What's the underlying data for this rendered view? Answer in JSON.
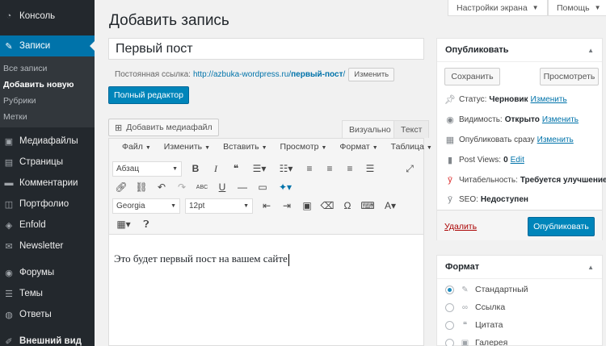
{
  "sidebar": {
    "items": [
      {
        "label": "Консоль",
        "icon": "dashboard-icon"
      },
      {
        "label": "Записи",
        "icon": "pin-icon"
      },
      {
        "label": "Медиафайлы",
        "icon": "media-icon"
      },
      {
        "label": "Страницы",
        "icon": "pages-icon"
      },
      {
        "label": "Комментарии",
        "icon": "comments-icon"
      },
      {
        "label": "Портфолио",
        "icon": "portfolio-icon"
      },
      {
        "label": "Enfold",
        "icon": "enfold-icon"
      },
      {
        "label": "Newsletter",
        "icon": "newsletter-icon"
      },
      {
        "label": "Форумы",
        "icon": "forums-icon"
      },
      {
        "label": "Темы",
        "icon": "topics-icon"
      },
      {
        "label": "Ответы",
        "icon": "replies-icon"
      },
      {
        "label": "Внешний вид",
        "icon": "appearance-icon"
      }
    ],
    "submenu": [
      "Все записи",
      "Добавить новую",
      "Рубрики",
      "Метки"
    ]
  },
  "header": {
    "screen_options": "Настройки экрана",
    "help": "Помощь",
    "page_title": "Добавить запись"
  },
  "post": {
    "title": "Первый пост",
    "permalink_label": "Постоянная ссылка:",
    "permalink_base": "http://azbuka-wordpress.ru/",
    "permalink_slug": "первый-пост",
    "permalink_tail": "/",
    "edit_label": "Изменить",
    "full_editor": "Полный редактор"
  },
  "editor": {
    "add_media": "Добавить медиафайл",
    "tab_visual": "Визуально",
    "tab_text": "Текст",
    "menus": [
      "Файл",
      "Изменить",
      "Вставить",
      "Просмотр",
      "Формат",
      "Таблица"
    ],
    "block_format": "Абзац",
    "font_family": "Georgia",
    "font_size": "12pt",
    "content": "Это будет первый пост на вашем сайте"
  },
  "publish": {
    "title": "Опубликовать",
    "save": "Сохранить",
    "preview": "Просмотреть",
    "status_label": "Статус:",
    "status_value": "Черновик",
    "visibility_label": "Видимость:",
    "visibility_value": "Открыто",
    "schedule_label": "Опубликовать сразу",
    "views_label": "Post Views:",
    "views_value": "0",
    "views_edit": "Edit",
    "readability_label": "Читабельность:",
    "readability_value": "Требуется улучшение",
    "seo_label": "SEO:",
    "seo_value": "Недоступен",
    "change": "Изменить",
    "delete": "Удалить",
    "publish": "Опубликовать"
  },
  "format": {
    "title": "Формат",
    "options": [
      "Стандартный",
      "Ссылка",
      "Цитата",
      "Галерея"
    ]
  }
}
